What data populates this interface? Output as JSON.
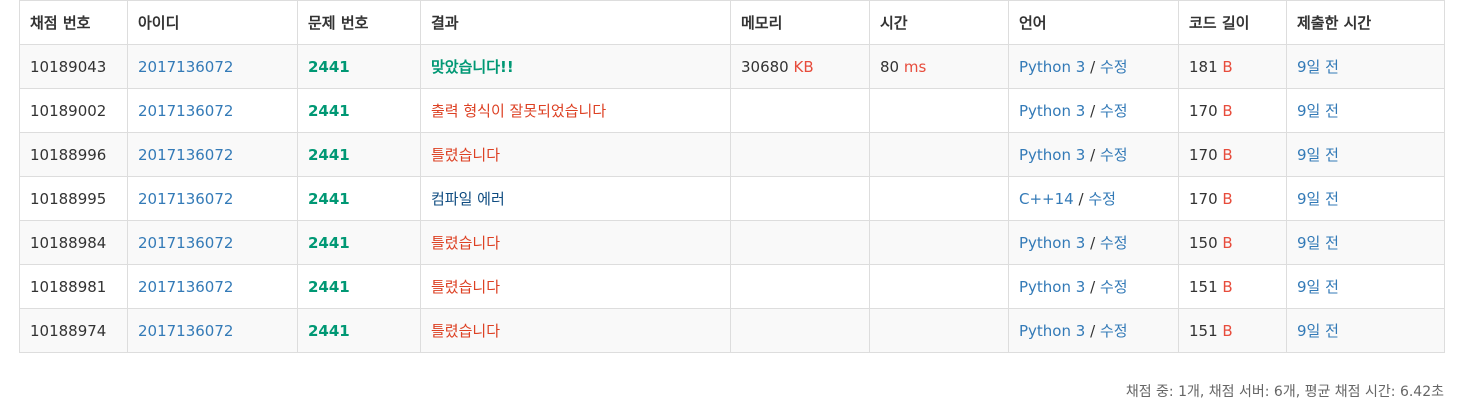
{
  "columns": [
    "채점 번호",
    "아이디",
    "문제 번호",
    "결과",
    "메모리",
    "시간",
    "언어",
    "코드 길이",
    "제출한 시간"
  ],
  "rows": [
    {
      "id": "10189043",
      "user": "2017136072",
      "problem": "2441",
      "result": "맞았습니다!!",
      "result_type": "ac",
      "memory": "30680",
      "memory_unit": "KB",
      "time": "80",
      "time_unit": "ms",
      "language": "Python 3",
      "edit": "수정",
      "length": "181",
      "length_unit": "B",
      "submitted": "9일 전"
    },
    {
      "id": "10189002",
      "user": "2017136072",
      "problem": "2441",
      "result": "출력 형식이 잘못되었습니다",
      "result_type": "wa",
      "memory": "",
      "memory_unit": "",
      "time": "",
      "time_unit": "",
      "language": "Python 3",
      "edit": "수정",
      "length": "170",
      "length_unit": "B",
      "submitted": "9일 전"
    },
    {
      "id": "10188996",
      "user": "2017136072",
      "problem": "2441",
      "result": "틀렸습니다",
      "result_type": "wa",
      "memory": "",
      "memory_unit": "",
      "time": "",
      "time_unit": "",
      "language": "Python 3",
      "edit": "수정",
      "length": "170",
      "length_unit": "B",
      "submitted": "9일 전"
    },
    {
      "id": "10188995",
      "user": "2017136072",
      "problem": "2441",
      "result": "컴파일 에러",
      "result_type": "ce",
      "memory": "",
      "memory_unit": "",
      "time": "",
      "time_unit": "",
      "language": "C++14",
      "edit": "수정",
      "length": "170",
      "length_unit": "B",
      "submitted": "9일 전"
    },
    {
      "id": "10188984",
      "user": "2017136072",
      "problem": "2441",
      "result": "틀렸습니다",
      "result_type": "wa",
      "memory": "",
      "memory_unit": "",
      "time": "",
      "time_unit": "",
      "language": "Python 3",
      "edit": "수정",
      "length": "150",
      "length_unit": "B",
      "submitted": "9일 전"
    },
    {
      "id": "10188981",
      "user": "2017136072",
      "problem": "2441",
      "result": "틀렸습니다",
      "result_type": "wa",
      "memory": "",
      "memory_unit": "",
      "time": "",
      "time_unit": "",
      "language": "Python 3",
      "edit": "수정",
      "length": "151",
      "length_unit": "B",
      "submitted": "9일 전"
    },
    {
      "id": "10188974",
      "user": "2017136072",
      "problem": "2441",
      "result": "틀렸습니다",
      "result_type": "wa",
      "memory": "",
      "memory_unit": "",
      "time": "",
      "time_unit": "",
      "language": "Python 3",
      "edit": "수정",
      "length": "151",
      "length_unit": "B",
      "submitted": "9일 전"
    }
  ],
  "footer": "채점 중: 1개, 채점 서버: 6개, 평균 채점 시간: 6.42초",
  "colors": {
    "link": "#337ab7",
    "accepted": "#009874",
    "wrong": "#dd4124",
    "compile_error": "#0f4c81",
    "unit": "#e74c3c",
    "border": "#dddddd",
    "stripe": "#f9f9f9"
  }
}
